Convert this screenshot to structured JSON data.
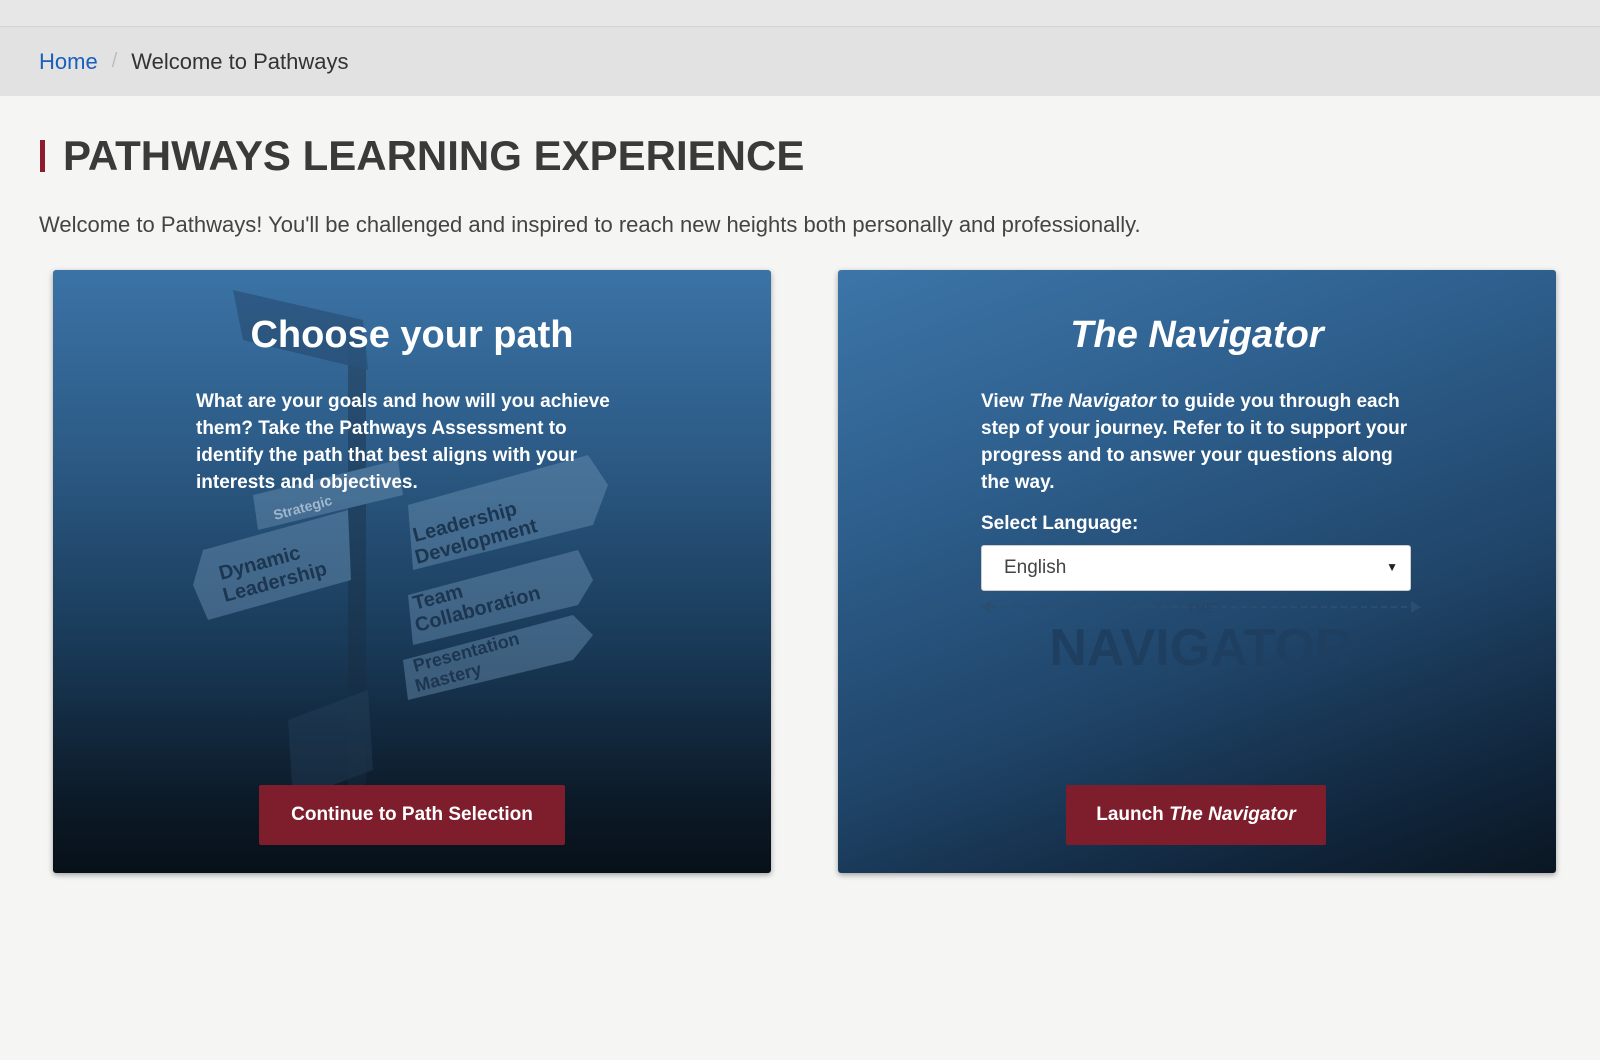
{
  "breadcrumb": {
    "home": "Home",
    "separator": "/",
    "current": "Welcome to Pathways"
  },
  "page": {
    "title": "PATHWAYS LEARNING EXPERIENCE",
    "intro": "Welcome to Pathways! You'll be challenged and inspired to reach new heights both personally and professionally."
  },
  "left_card": {
    "title": "Choose your path",
    "description": "What are your goals and how will you achieve them? Take the Pathways Assessment to identify the path that best aligns with your interests and objectives.",
    "signs": [
      "Strategic",
      "Dynamic Leadership",
      "Leadership Development",
      "Team Collaboration",
      "Presentation Mastery"
    ],
    "button_label": "Continue to Path Selection"
  },
  "right_card": {
    "title": "The Navigator",
    "description_prefix": "View ",
    "description_italic": "The Navigator",
    "description_suffix": " to guide you through each step of your journey. Refer to it to support your progress and to answer your questions along the way.",
    "language_label": "Select Language:",
    "language_value": "English",
    "watermark_small": "THE",
    "watermark_large": "NAVIGATOR",
    "button_prefix": "Launch ",
    "button_italic": "The Navigator"
  },
  "colors": {
    "accent": "#7e1d2c",
    "link": "#1a5fbd",
    "card_blue": "#2c5b86"
  }
}
